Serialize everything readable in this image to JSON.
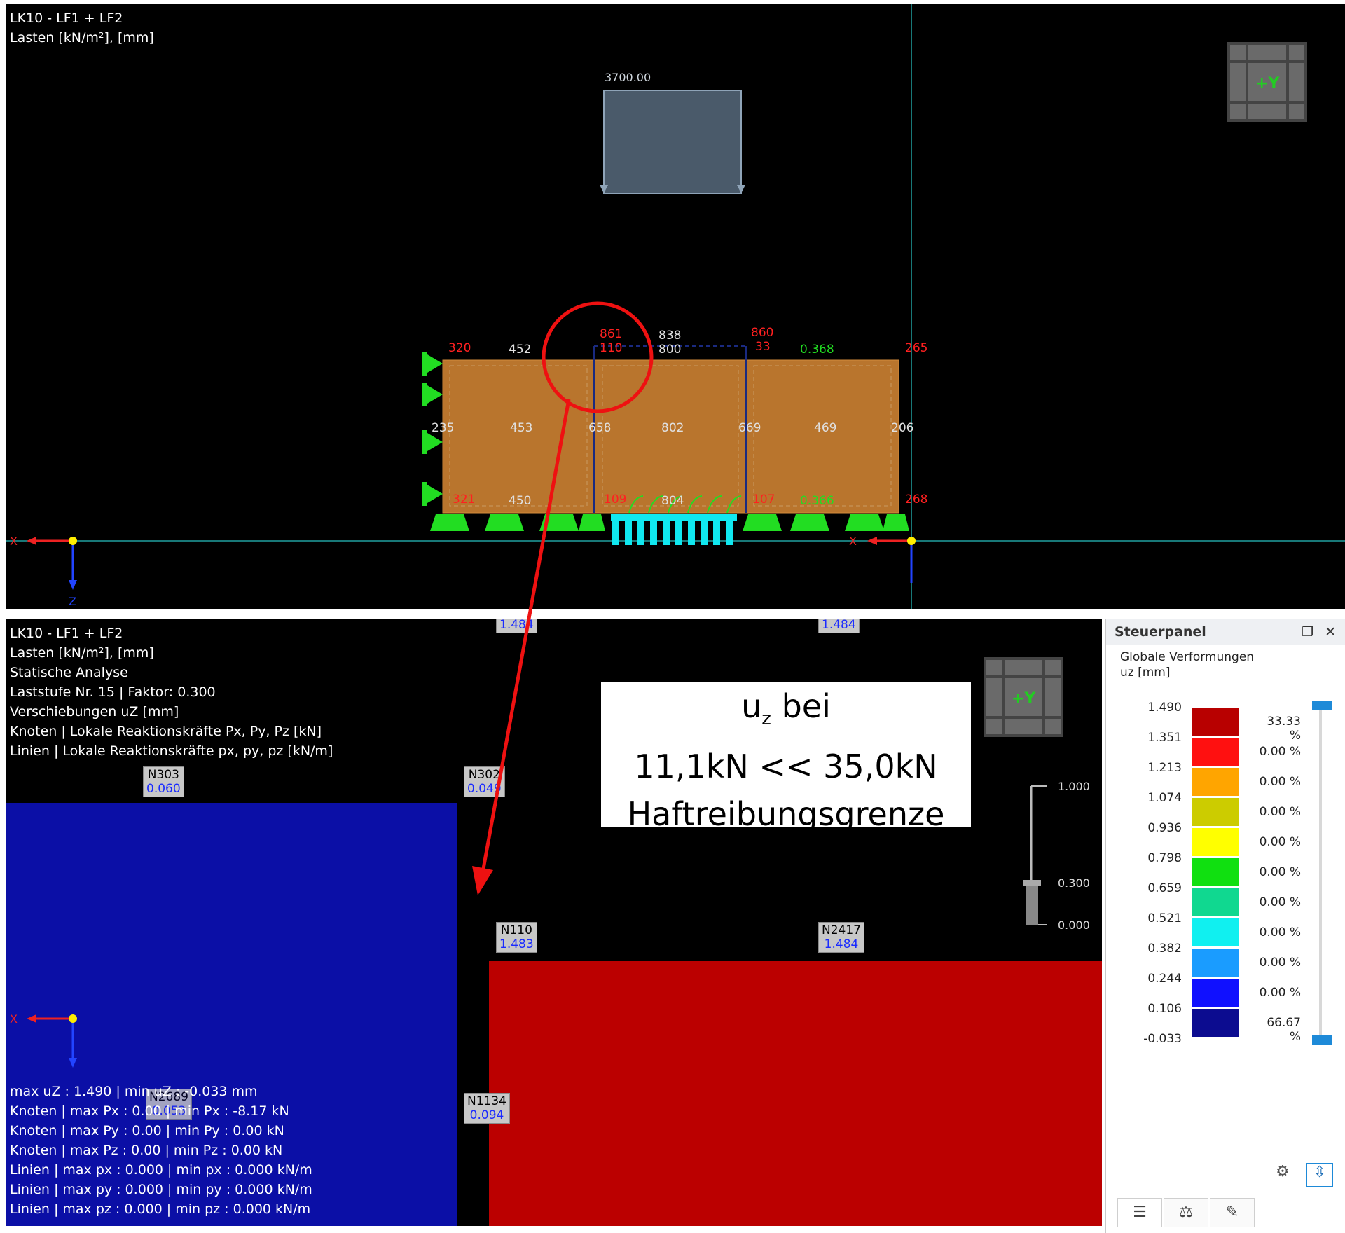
{
  "top_view": {
    "info_lines": [
      "LK10 - LF1 + LF2",
      "Lasten [kN/m²], [mm]"
    ],
    "load_value": "3700.00",
    "orientation_label": "+Y",
    "labels_red": [
      "320",
      "861",
      "860",
      "265",
      "321",
      "109",
      "107",
      "268"
    ],
    "labels_red_sub": [
      "110",
      "33"
    ],
    "labels_white": [
      "452",
      "838",
      "800",
      "235",
      "453",
      "658",
      "802",
      "669",
      "469",
      "206",
      "450",
      "804"
    ],
    "labels_green": [
      "0.368",
      "0.366"
    ],
    "axis_x": "X",
    "axis_z": "Z"
  },
  "bottom_view": {
    "info_lines": [
      "LK10 - LF1 + LF2",
      "Lasten [kN/m²], [mm]",
      "Statische Analyse",
      "Laststufe Nr. 15 | Faktor: 0.300",
      "Verschiebungen uZ [mm]",
      "Knoten | Lokale Reaktionskräfte Px, Py, Pz [kN]",
      "Linien | Lokale Reaktionskräfte px, py, pz [kN/m]"
    ],
    "summary_lines": [
      "max uZ : 1.490 | min uZ : -0.033 mm",
      "Knoten | max Px : 0.00 | min Px : -8.17 kN",
      "Knoten | max Py : 0.00 | min Py : 0.00 kN",
      "Knoten | max Pz : 0.00 | min Pz : 0.00 kN",
      "Linien | max px : 0.000 | min px : 0.000 kN/m",
      "Linien | max py : 0.000 | min py : 0.000 kN/m",
      "Linien | max pz : 0.000 | min pz : 0.000 kN/m"
    ],
    "nodes": [
      {
        "name": "N303",
        "value": "0.060"
      },
      {
        "name": "N302",
        "value": "0.049"
      },
      {
        "name": "N110",
        "value": "1.483"
      },
      {
        "name": "N2417",
        "value": "1.484"
      },
      {
        "name": "N1134",
        "value": "0.094"
      },
      {
        "name": "N2689",
        "value": "0.053"
      },
      {
        "name": "",
        "value": "1.484"
      },
      {
        "name": "",
        "value": "1.484"
      }
    ],
    "slider": {
      "top": "1.000",
      "mid": "0.300",
      "bottom": "0.000"
    },
    "orientation_label": "+Y",
    "axis_x": "X",
    "axis_z": "Z",
    "colors": {
      "blue_region": "#0b0fa6",
      "red_region": "#bb0000"
    }
  },
  "callout": {
    "line1_main": "u",
    "line1_sub": "z",
    "line1_rest": " bei",
    "line2": "11,1kN << 35,0kN",
    "line3": "Haftreibungsgrenze"
  },
  "panel": {
    "title": "Steuerpanel",
    "section_title": "Globale Verformungen",
    "section_unit": "uz [mm]",
    "scale_values": [
      "1.490",
      "1.351",
      "1.213",
      "1.074",
      "0.936",
      "0.798",
      "0.659",
      "0.521",
      "0.382",
      "0.244",
      "0.106",
      "-0.033"
    ],
    "scale_percent": [
      "33.33 %",
      "0.00 %",
      "0.00 %",
      "0.00 %",
      "0.00 %",
      "0.00 %",
      "0.00 %",
      "0.00 %",
      "0.00 %",
      "0.00 %",
      "66.67 %"
    ],
    "scale_colors": [
      "#b80000",
      "#ff1010",
      "#ffa500",
      "#cccc00",
      "#ffff00",
      "#10e010",
      "#10d890",
      "#10f0f0",
      "#1a9cff",
      "#1010ff",
      "#0c0c90"
    ]
  }
}
